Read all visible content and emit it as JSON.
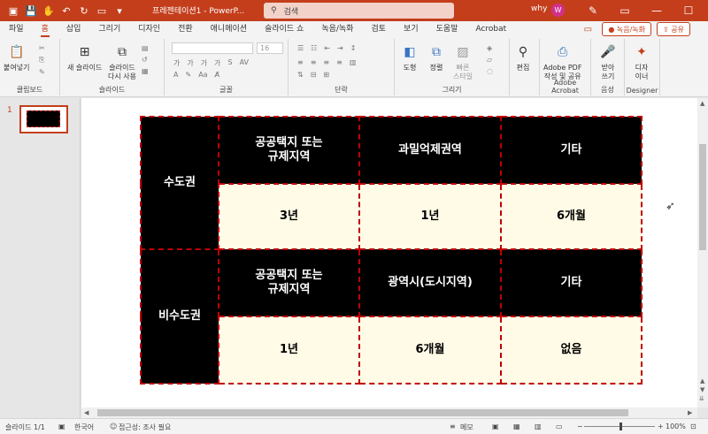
{
  "titlebar": {
    "title": "프레젠테이션1 - PowerP...",
    "search_placeholder": "검색",
    "user_name": "why",
    "avatar_initial": "W"
  },
  "tabs": [
    "파일",
    "홈",
    "삽입",
    "그리기",
    "디자인",
    "전환",
    "애니메이션",
    "슬라이드 쇼",
    "녹음/녹화",
    "검토",
    "보기",
    "도움말",
    "Acrobat"
  ],
  "tab_right": {
    "record": "녹음/녹화",
    "share": "공유"
  },
  "ribbon": {
    "clipboard": {
      "paste": "붙여넣기",
      "label": "클립보드"
    },
    "slides": {
      "new_slide_1": "새 슬라이드",
      "reuse_1": "슬라이드",
      "reuse_2": "다시 사용",
      "label": "슬라이드"
    },
    "font": {
      "size": "16",
      "label": "글꼴"
    },
    "paragraph": {
      "label": "단락"
    },
    "drawing": {
      "shape": "도형",
      "arrange": "정렬",
      "quick_1": "빠른",
      "quick_2": "스타일",
      "label": "그리기"
    },
    "editing": {
      "edit": "편집"
    },
    "acrobat": {
      "line1": "Adobe PDF",
      "line2": "작성 및 공유",
      "label": "Adobe Acrobat"
    },
    "voice": {
      "line1": "받아",
      "line2": "쓰기",
      "label": "음성"
    },
    "designer": {
      "line1": "디자",
      "line2": "이너",
      "label": "Designer"
    }
  },
  "slides_panel": {
    "slide_number": "1"
  },
  "table": {
    "metro": {
      "region": "수도권",
      "headers": [
        "공공택지 또는\n규제지역",
        "과밀억제권역",
        "기타"
      ],
      "values": [
        "3년",
        "1년",
        "6개월"
      ]
    },
    "non_metro": {
      "region": "비수도권",
      "headers": [
        "공공택지 또는\n규제지역",
        "광역시(도시지역)",
        "기타"
      ],
      "values": [
        "1년",
        "6개월",
        "없음"
      ]
    }
  },
  "status": {
    "slide_info": "슬라이드 1/1",
    "language": "한국어",
    "accessibility": "접근성: 조사 필요",
    "notes": "메모",
    "zoom": "100%"
  }
}
